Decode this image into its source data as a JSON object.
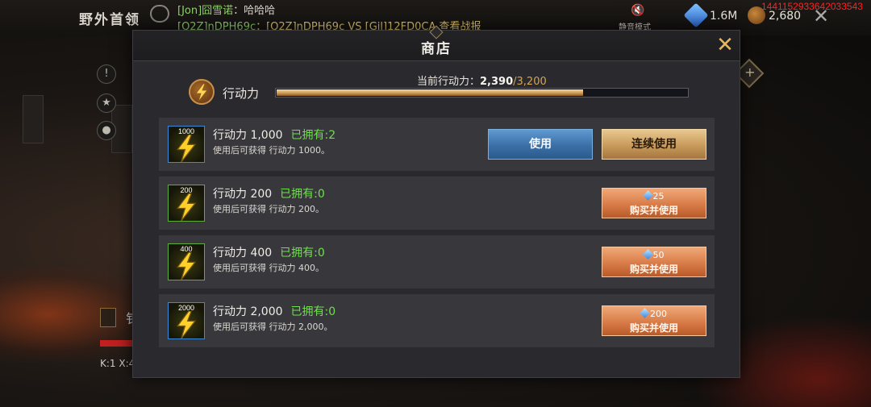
{
  "hud": {
    "mode_title": "野外首领",
    "chat": [
      {
        "speaker": "[Jon]囧雪诺",
        "message": "：哈哈哈"
      },
      {
        "speaker": "[Q2Z]nDPH69c",
        "message": "：[Q2Z]nDPH69c VS [Gil]12FD0CA,查看战报"
      }
    ],
    "mute_label": "静音模式",
    "gems": "1.6M",
    "coins": "2,680",
    "debug_id": "1441152933642033543",
    "bottom_text": "钅",
    "coords": "K:1 X:4"
  },
  "shop": {
    "title": "商店",
    "energy": {
      "label": "行动力",
      "current_label": "当前行动力：",
      "current": "2,390",
      "separator": "/",
      "max": "3,200",
      "progress": 0.747
    },
    "items": [
      {
        "amount": "1000",
        "name": "行动力 1,000",
        "owned": "已拥有:2",
        "desc": "使用后可获得 行动力 1000。",
        "use_label": "使用",
        "multi_label": "连续使用"
      },
      {
        "amount": "200",
        "name": "行动力 200",
        "owned": "已拥有:0",
        "desc": "使用后可获得 行动力 200。",
        "price": "25",
        "buy_label": "购买并使用"
      },
      {
        "amount": "400",
        "name": "行动力 400",
        "owned": "已拥有:0",
        "desc": "使用后可获得 行动力 400。",
        "price": "50",
        "buy_label": "购买并使用"
      },
      {
        "amount": "2000",
        "name": "行动力 2,000",
        "owned": "已拥有:0",
        "desc": "使用后可获得 行动力 2,000。",
        "price": "200",
        "buy_label": "购买并使用"
      }
    ]
  },
  "colors": {
    "owned_green": "#6fe04a",
    "close_gold": "#e6b760",
    "use_blue": "#3a6fa6",
    "buy_orange": "#d87c48",
    "debug_red": "#ff2222"
  },
  "icons": {
    "energy": "lightning-bolt-icon",
    "gem": "diamond-gem-icon",
    "close": "close-x-icon"
  }
}
